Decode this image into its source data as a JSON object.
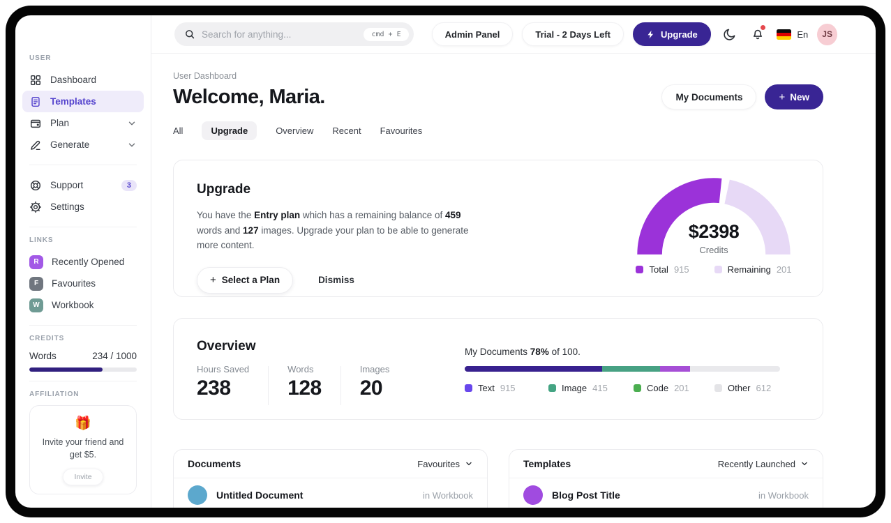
{
  "icons": {
    "plus": "+",
    "gift": "🎁"
  },
  "colors": {
    "accent": "#392594",
    "sidebar_active": "#5544cd",
    "credits_fill": "#31207f"
  },
  "sidebar": {
    "user_label": "USER",
    "items": [
      {
        "label": "Dashboard"
      },
      {
        "label": "Templates",
        "active": true
      },
      {
        "label": "Plan"
      },
      {
        "label": "Generate"
      }
    ],
    "support": {
      "label": "Support",
      "badge": "3"
    },
    "settings_label": "Settings",
    "links_label": "LINKS",
    "links": [
      {
        "initial": "R",
        "label": "Recently Opened",
        "color": "#a259e6"
      },
      {
        "initial": "F",
        "label": "Favourites",
        "color": "#70767f"
      },
      {
        "initial": "W",
        "label": "Workbook",
        "color": "#6f9b94"
      }
    ],
    "credits": {
      "label": "CREDITS",
      "name": "Words",
      "value": "234 / 1000",
      "percent": 68
    },
    "affiliation": {
      "label": "AFFILIATION",
      "emoji": "🎁",
      "text": "Invite your friend and get $5.",
      "button": "Invite"
    }
  },
  "topbar": {
    "search": {
      "placeholder": "Search for anything...",
      "shortcut": "cmd + E"
    },
    "admin_panel": "Admin Panel",
    "trial": "Trial - 2 Days Left",
    "upgrade": "Upgrade",
    "language": "En",
    "avatar_initials": "JS"
  },
  "header": {
    "breadcrumb": "User Dashboard",
    "title": "Welcome, Maria.",
    "my_documents": "My Documents",
    "new_label": "New",
    "tabs": [
      {
        "label": "All"
      },
      {
        "label": "Upgrade",
        "active": true
      },
      {
        "label": "Overview"
      },
      {
        "label": "Recent"
      },
      {
        "label": "Favourites"
      }
    ]
  },
  "upgrade_card": {
    "title": "Upgrade",
    "body_1": "You have the ",
    "body_bold_1": "Entry plan",
    "body_2": " which has a remaining balance of ",
    "body_bold_2": "459",
    "body_3": " words and ",
    "body_bold_3": "127",
    "body_4": " images. Upgrade your plan to be able to generate more content.",
    "select_plan": "Select a Plan",
    "dismiss": "Dismiss"
  },
  "overview_card": {
    "title": "Overview",
    "stats": [
      {
        "label": "Hours Saved",
        "value": "238"
      },
      {
        "label": "Words",
        "value": "128"
      },
      {
        "label": "Images",
        "value": "20"
      }
    ]
  },
  "documents_card": {
    "title": "Documents",
    "filter": "Favourites",
    "items": [
      {
        "title": "Untitled Document",
        "location": "in Workbook",
        "color": "#5ca8cd"
      }
    ]
  },
  "templates_card": {
    "title": "Templates",
    "filter": "Recently Launched",
    "items": [
      {
        "title": "Blog Post Title",
        "location": "in Workbook",
        "color": "#a04be0"
      }
    ]
  },
  "chart_data": [
    {
      "type": "pie",
      "variant": "half-donut-gauge",
      "center_value": "$2398",
      "center_label": "Credits",
      "legend_position": "bottom",
      "legend": [
        {
          "name": "Total",
          "value": "915",
          "color": "#9b32d9"
        },
        {
          "name": "Remaining",
          "value": "201",
          "color": "#e7d9f6"
        }
      ]
    },
    {
      "type": "bar",
      "variant": "stacked-progress",
      "label_prefix": "My Documents ",
      "label_bold": "78%",
      "label_suffix": " of 100.",
      "track_color": "#e9e9ec",
      "bar_segments": [
        {
          "color": "#38218f",
          "width_pct": 43.5
        },
        {
          "color": "#47a183",
          "width_pct": 18.5
        },
        {
          "color": "#a64fd6",
          "width_pct": 9.5
        }
      ],
      "legend": [
        {
          "name": "Text",
          "value": "915",
          "color": "#6847ec"
        },
        {
          "name": "Image",
          "value": "415",
          "color": "#44a483"
        },
        {
          "name": "Code",
          "value": "201",
          "color": "#4bae50"
        },
        {
          "name": "Other",
          "value": "612",
          "color": "#e4e4e7"
        }
      ]
    }
  ]
}
